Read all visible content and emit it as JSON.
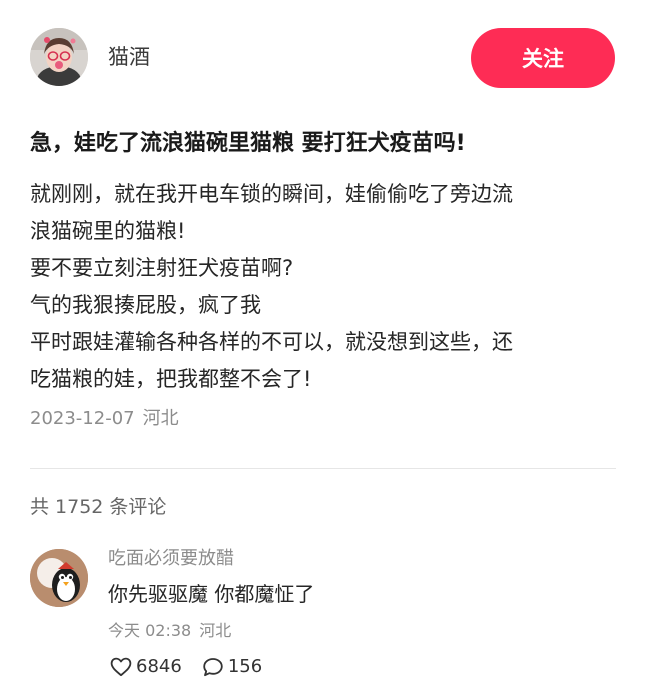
{
  "author": {
    "name": "猫酒",
    "avatar_icon": "user-avatar-photo",
    "follow_label": "关注"
  },
  "post": {
    "title": "急，娃吃了流浪猫碗里猫粮 要打狂犬疫苗吗!",
    "body_lines": [
      "就刚刚，就在我开电车锁的瞬间，娃偷偷吃了旁边流",
      "浪猫碗里的猫粮!",
      "要不要立刻注射狂犬疫苗啊?",
      "气的我狠揍屁股，疯了我",
      "平时跟娃灌输各种各样的不可以，就没想到这些，还",
      "吃猫粮的娃，把我都整不会了!"
    ],
    "date": "2023-12-07",
    "location": "河北"
  },
  "comments_header": {
    "prefix": "共",
    "count": "1752",
    "suffix": "条评论"
  },
  "comments": [
    {
      "user": "吃面必须要放醋",
      "avatar_icon": "penguin-avatar",
      "text": "你先驱驱魔 你都魔怔了",
      "time": "今天 02:38",
      "location": "河北",
      "likes": "6846",
      "replies": "156",
      "like_icon": "heart-outline-icon",
      "reply_icon": "comment-bubble-icon"
    }
  ],
  "colors": {
    "accent": "#fe2c55",
    "text_primary": "#1a1a1a",
    "text_secondary": "#8c8c8c",
    "divider": "#e6e6e6"
  }
}
